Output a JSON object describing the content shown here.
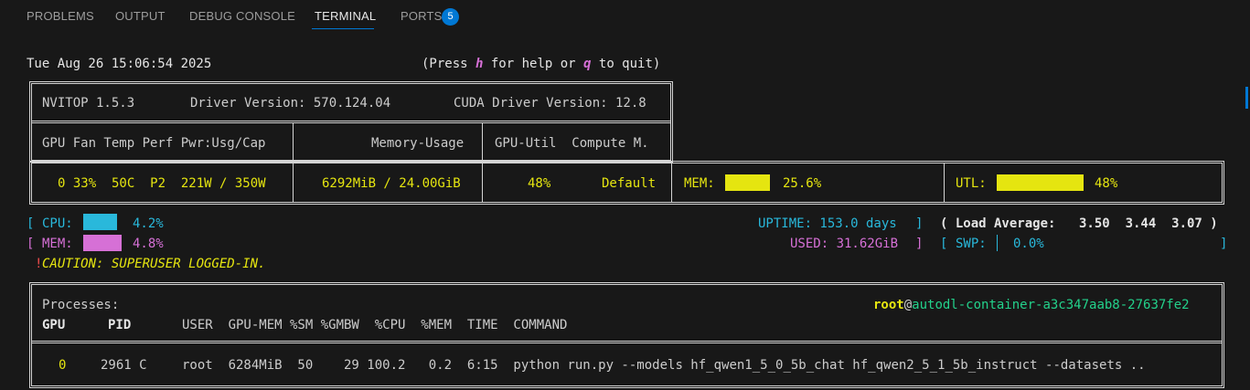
{
  "tabs": {
    "problems": "PROBLEMS",
    "output": "OUTPUT",
    "debug_console": "DEBUG CONSOLE",
    "terminal": "TERMINAL",
    "ports": "PORTS",
    "ports_count": "5"
  },
  "terminal": {
    "datetime": "Tue Aug 26 15:06:54 2025",
    "help": {
      "open": "(Press ",
      "h_key": "h",
      "mid": " for help or ",
      "q_key": "q",
      "close": " to quit)"
    },
    "header": {
      "nvitop": "NVITOP 1.5.3",
      "driver": "Driver Version: 570.124.04",
      "cuda": "CUDA Driver Version: 12.8",
      "col_gpu": "GPU Fan Temp Perf Pwr:Usg/Cap",
      "col_memory": "Memory-Usage",
      "col_util": "GPU-Util  Compute M."
    },
    "gpu": {
      "stats": "0 33%  50C  P2  221W / 350W",
      "memory_usage": "6292MiB / 24.00GiB",
      "util": "48%",
      "compute_mode": "Default",
      "mem_label": "MEM:",
      "mem_percent": "25.6%",
      "mem_fraction": 0.256,
      "utl_label": "UTL:",
      "utl_percent": "48%",
      "utl_fraction": 0.48
    },
    "host": {
      "cpu_label": "CPU:",
      "cpu_percent": "4.2%",
      "cpu_fraction": 0.042,
      "mem_label": "MEM:",
      "mem_percent": "4.8%",
      "mem_fraction": 0.048,
      "uptime": "UPTIME: 153.0 days",
      "load_label": "( Load Average:",
      "load_values": "3.50  3.44  3.07 )",
      "used": "USED: 31.62GiB",
      "swp_label": "SWP:",
      "swp_percent": "0.0%",
      "caution_mark": "!",
      "caution": "CAUTION: SUPERUSER LOGGED-IN."
    },
    "processes": {
      "title": "Processes:",
      "user": "root",
      "at": "@",
      "host": "autodl-container-a3c347aab8-27637fe2",
      "col_gpu": "GPU",
      "col_pid": "PID",
      "col_rest": "USER  GPU-MEM %SM %GMBW  %CPU  %MEM  TIME  COMMAND",
      "rows": [
        {
          "gpu": "0",
          "pid": "2961 C",
          "rest": "root  6284MiB  50    29 100.2   0.2  6:15  python run.py --models hf_qwen1_5_0_5b_chat hf_qwen2_5_1_5b_instruct --datasets .."
        }
      ]
    }
  },
  "colors": {
    "accent": "#0078d4",
    "yellow": "#e5e510",
    "cyan": "#29b8db",
    "magenta": "#d670d6",
    "green": "#23d18b",
    "red": "#f14c4c"
  }
}
